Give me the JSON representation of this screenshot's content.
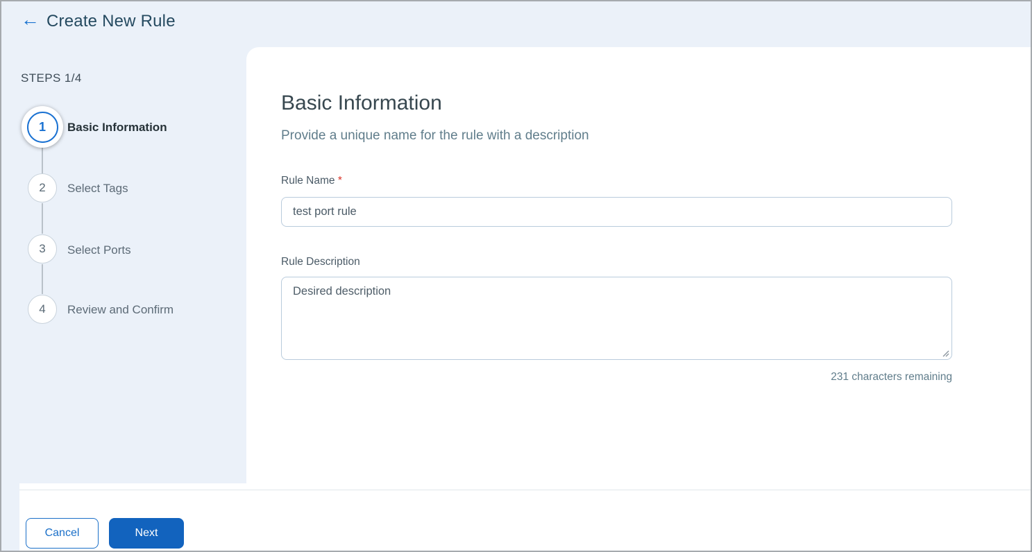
{
  "header": {
    "title": "Create New Rule"
  },
  "icons": {
    "back_arrow": "←"
  },
  "steps_panel": {
    "progress_label": "STEPS 1/4",
    "steps": [
      {
        "number": "1",
        "label": "Basic Information",
        "state": "active"
      },
      {
        "number": "2",
        "label": "Select Tags",
        "state": "upcoming"
      },
      {
        "number": "3",
        "label": "Select Ports",
        "state": "upcoming"
      },
      {
        "number": "4",
        "label": "Review and Confirm",
        "state": "upcoming"
      }
    ]
  },
  "main": {
    "heading": "Basic Information",
    "subheading": "Provide a unique name for the rule with a description",
    "rule_name": {
      "label": "Rule Name",
      "required_marker": "*",
      "value": "test port rule"
    },
    "rule_description": {
      "label": "Rule Description",
      "value": "Desired description",
      "remaining_text": "231 characters remaining"
    }
  },
  "footer": {
    "cancel_label": "Cancel",
    "next_label": "Next"
  },
  "colors": {
    "accent_blue": "#1971d2",
    "primary_button_bg": "#1263be",
    "page_background": "#ebf1f9",
    "heading_text": "#37474f",
    "muted_text": "#607d8b",
    "required_red": "#d93025"
  }
}
